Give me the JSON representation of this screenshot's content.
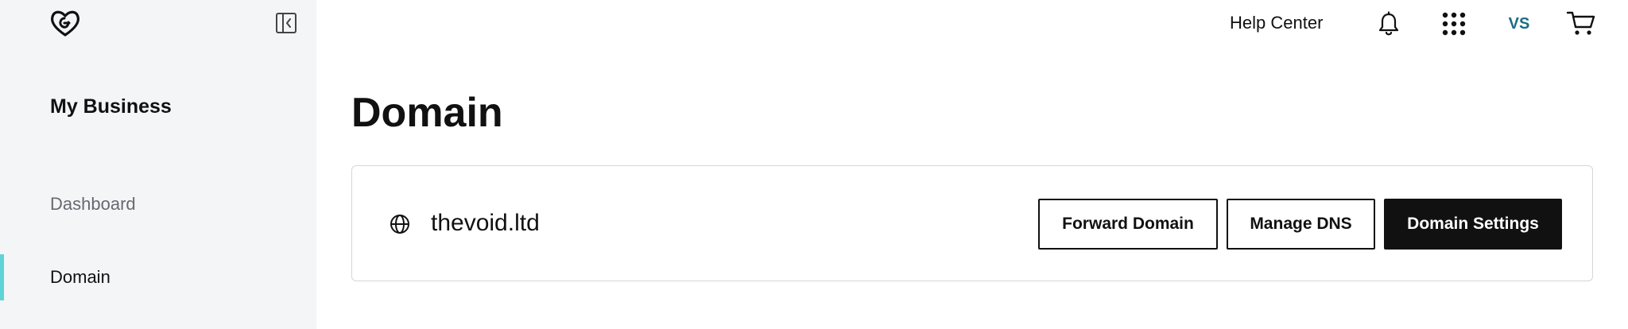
{
  "sidebar": {
    "logo_icon": "godaddy-logo-icon",
    "collapse_icon": "collapse-sidebar-icon",
    "business_title": "My Business",
    "items": [
      {
        "label": "Dashboard",
        "active": false
      },
      {
        "label": "Domain",
        "active": true
      }
    ],
    "active_indicator_color": "#5ed3d8"
  },
  "topbar": {
    "help_center": "Help Center",
    "bell_icon": "bell-icon",
    "apps_icon": "apps-grid-icon",
    "avatar_initials": "VS",
    "cart_icon": "cart-icon"
  },
  "main": {
    "title": "Domain",
    "domain_card": {
      "globe_icon": "globe-icon",
      "domain_name": "thevoid.ltd",
      "buttons": {
        "forward": "Forward Domain",
        "manage_dns": "Manage DNS",
        "settings": "Domain Settings"
      }
    }
  },
  "colors": {
    "sidebar_bg": "#f4f5f7",
    "primary_button": "#111111",
    "avatar_text": "#1b6d85"
  }
}
